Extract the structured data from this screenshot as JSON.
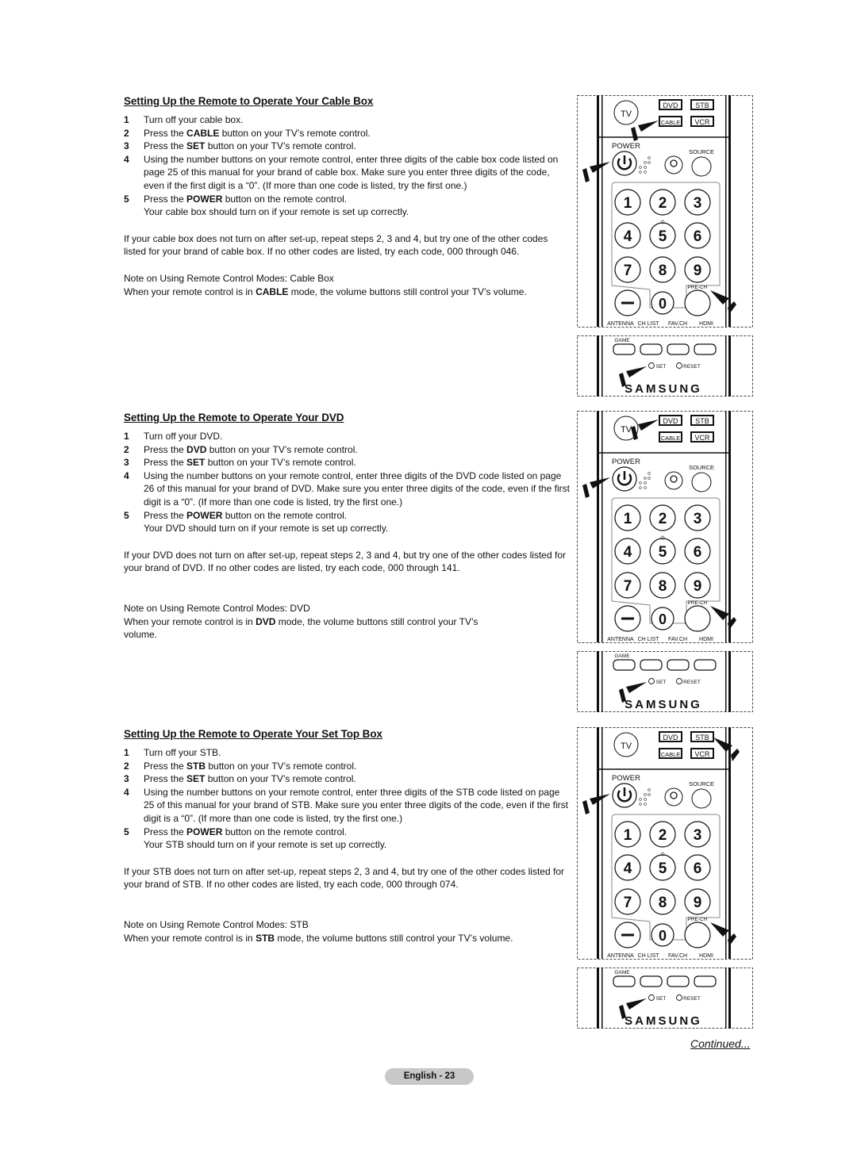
{
  "sections": [
    {
      "id": "cable",
      "title": "Setting Up the Remote to Operate Your Cable Box",
      "steps": [
        {
          "n": "1",
          "pre": "Turn off your cable box.",
          "bold": "",
          "post": ""
        },
        {
          "n": "2",
          "pre": "Press the ",
          "bold": "CABLE",
          "post": " button on your TV’s remote control."
        },
        {
          "n": "3",
          "pre": "Press the ",
          "bold": "SET",
          "post": " button on your TV’s remote control."
        },
        {
          "n": "4",
          "pre": "Using the number buttons on your remote control, enter three digits of the cable box code listed on page 25 of this manual for your brand of cable box. Make sure you enter three digits of the code, even if the first digit is a “0”. (If more than one code is listed, try the first one.)",
          "bold": "",
          "post": ""
        },
        {
          "n": "5",
          "pre": "Press the ",
          "bold": "POWER",
          "post": " button on the remote control."
        }
      ],
      "result": "Your cable box should turn on if your remote is set up correctly.",
      "retry": "If your cable box does not turn on after set-up, repeat steps 2, 3 and 4, but try one of the other codes listed for your brand of cable box. If no other codes are listed, try each code, 000 through 046.",
      "note_title": "Note on Using Remote Control Modes: Cable Box",
      "note_pre": "When your remote control is in ",
      "note_bold": "CABLE",
      "note_post": " mode, the volume buttons still control your TV’s volume.",
      "highlight": "CABLE"
    },
    {
      "id": "dvd",
      "title": "Setting Up the Remote to Operate Your DVD",
      "steps": [
        {
          "n": "1",
          "pre": "Turn off your DVD.",
          "bold": "",
          "post": ""
        },
        {
          "n": "2",
          "pre": "Press the ",
          "bold": "DVD",
          "post": " button on your TV’s remote control."
        },
        {
          "n": "3",
          "pre": "Press the ",
          "bold": "SET",
          "post": " button on your TV’s remote control."
        },
        {
          "n": "4",
          "pre": "Using the number buttons on your remote control, enter three digits of the DVD code listed on page 26 of this manual for your brand of DVD. Make sure you enter three digits of the code, even if the first digit is a “0”. (If more than one code is listed, try the first one.)",
          "bold": "",
          "post": ""
        },
        {
          "n": "5",
          "pre": "Press the ",
          "bold": "POWER",
          "post": " button on the remote control."
        }
      ],
      "result": "Your DVD should turn on if your remote is set up correctly.",
      "retry": "If your DVD does not turn on after set-up, repeat steps 2, 3 and 4, but try one of the other codes listed for your brand of DVD. If no other codes are listed, try each code, 000 through 141.",
      "note_title": "Note on Using Remote Control Modes: DVD",
      "note_pre": "When your remote control is in ",
      "note_bold": "DVD",
      "note_post": " mode, the volume buttons still control your TV’s volume.",
      "highlight": "DVD"
    },
    {
      "id": "stb",
      "title": "Setting Up the Remote to Operate Your Set Top Box",
      "steps": [
        {
          "n": "1",
          "pre": "Turn off your STB.",
          "bold": "",
          "post": ""
        },
        {
          "n": "2",
          "pre": "Press the ",
          "bold": "STB",
          "post": " button on your TV’s remote control."
        },
        {
          "n": "3",
          "pre": "Press the ",
          "bold": "SET",
          "post": " button on your TV’s remote control."
        },
        {
          "n": "4",
          "pre": "Using the number buttons on your remote control, enter three digits of the STB code listed on page 25 of this manual for your brand of STB. Make sure you enter three digits of the code, even if the first digit is a “0”. (If more than one code is listed, try the first one.)",
          "bold": "",
          "post": ""
        },
        {
          "n": "5",
          "pre": "Press the ",
          "bold": "POWER",
          "post": " button on the remote control."
        }
      ],
      "result": "Your STB should turn on if your remote is set up correctly.",
      "retry": "If your STB does not turn on after set-up, repeat steps 2, 3 and 4, but try one of the other codes listed for your brand of STB. If no other codes are listed, try each code, 000 through 074.",
      "note_title": "Note on Using Remote Control Modes: STB",
      "note_pre": "When your remote control is in ",
      "note_bold": "STB",
      "note_post": " mode, the volume buttons still control your TV’s volume.",
      "highlight": "STB"
    }
  ],
  "remote": {
    "tv": "TV",
    "modes": [
      "DVD",
      "STB",
      "CABLE",
      "VCR"
    ],
    "power": "POWER",
    "source": "SOURCE",
    "digits": [
      "1",
      "2",
      "3",
      "4",
      "5",
      "6",
      "7",
      "8",
      "9"
    ],
    "dash": "—",
    "zero": "0",
    "prech": "PRE-CH",
    "bottom_labels": [
      "ANTENNA",
      "CH LIST",
      "FAV.CH",
      "HDMI"
    ],
    "game": "GAME",
    "set": "SET",
    "reset": "RESET",
    "brand": "SAMSUNG"
  },
  "footer": {
    "continued": "Continued...",
    "page_label": "English - 23"
  }
}
